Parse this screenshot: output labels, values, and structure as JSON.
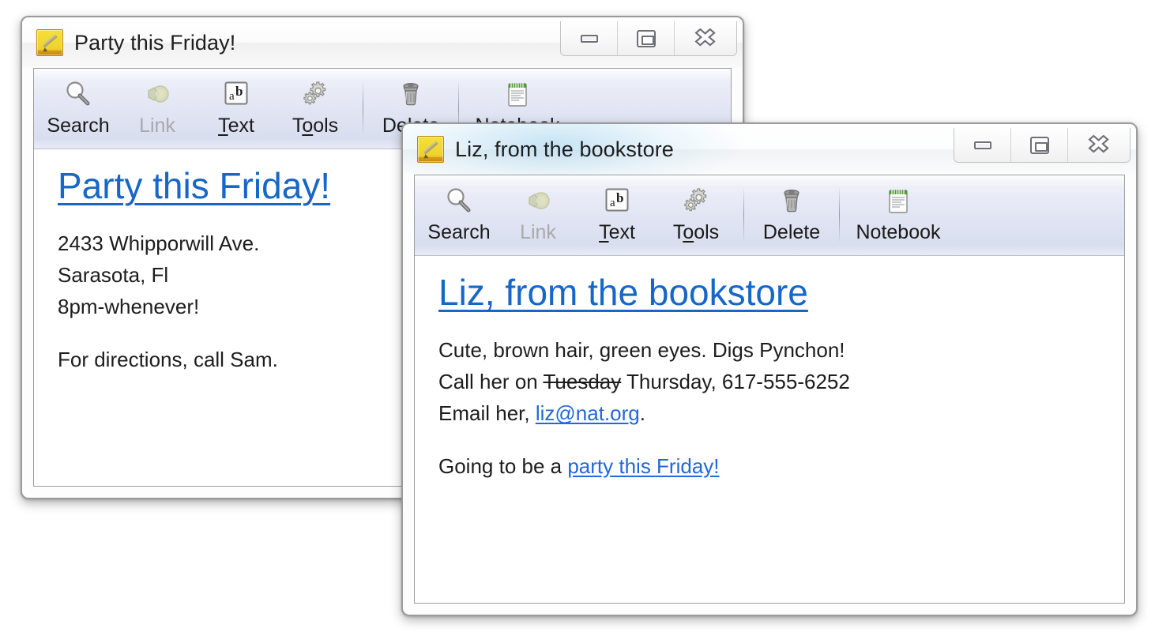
{
  "windows": [
    {
      "id": "party",
      "state": "inactive",
      "app_icon": "note-pencil-icon",
      "title": "Party this Friday!",
      "controls": {
        "minimize": "minimize-icon",
        "restore": "restore-icon",
        "close": "close-icon"
      },
      "toolbar": {
        "items": [
          {
            "label": "Search",
            "icon": "magnifier-icon",
            "disabled": false,
            "accel": ""
          },
          {
            "label": "Link",
            "icon": "link-icon",
            "disabled": true,
            "accel": ""
          },
          {
            "label": "Text",
            "icon": "ab-text-icon",
            "disabled": false,
            "accel": "T"
          },
          {
            "label": "Tools",
            "icon": "gears-icon",
            "disabled": false,
            "accel": "o"
          },
          {
            "label": "Delete",
            "icon": "trashcan-icon",
            "disabled": false,
            "accel": ""
          },
          {
            "label": "Notebook",
            "icon": "notepad-icon",
            "disabled": false,
            "accel": ""
          }
        ]
      },
      "note": {
        "heading": "Party this Friday!",
        "lines": [
          "2433 Whipporwill Ave.",
          "Sarasota, Fl",
          "8pm-whenever!",
          "",
          "For directions, call Sam."
        ]
      }
    },
    {
      "id": "liz",
      "state": "active",
      "app_icon": "note-pencil-icon",
      "title": "Liz, from the bookstore",
      "controls": {
        "minimize": "minimize-icon",
        "restore": "restore-icon",
        "close": "close-icon"
      },
      "toolbar": {
        "items": [
          {
            "label": "Search",
            "icon": "magnifier-icon",
            "disabled": false,
            "accel": ""
          },
          {
            "label": "Link",
            "icon": "link-icon",
            "disabled": true,
            "accel": ""
          },
          {
            "label": "Text",
            "icon": "ab-text-icon",
            "disabled": false,
            "accel": "T"
          },
          {
            "label": "Tools",
            "icon": "gears-icon",
            "disabled": false,
            "accel": "o"
          },
          {
            "label": "Delete",
            "icon": "trashcan-icon",
            "disabled": false,
            "accel": ""
          },
          {
            "label": "Notebook",
            "icon": "notepad-icon",
            "disabled": false,
            "accel": ""
          }
        ]
      },
      "note": {
        "heading": "Liz, from the bookstore",
        "line1": "Cute, brown hair, green eyes. Digs Pynchon!",
        "line2_prefix": "Call her on ",
        "line2_struck": "Tuesday",
        "line2_suffix": " Thursday, 617-555-6252",
        "line3_prefix": "Email her, ",
        "line3_link": "liz@nat.org",
        "line3_suffix": ".",
        "line4_prefix": "Going to be a ",
        "line4_link": "party this Friday!"
      }
    }
  ],
  "colors": {
    "link": "#2168d8",
    "heading_link": "#1767c8",
    "text": "#1d1d1d",
    "disabled_text": "#a9a9ad",
    "toolbar_top": "#fdfdfe",
    "toolbar_bottom": "#d9deef",
    "window_border": "#9b9b9b",
    "note_icon_yellow": "#efd32c"
  }
}
